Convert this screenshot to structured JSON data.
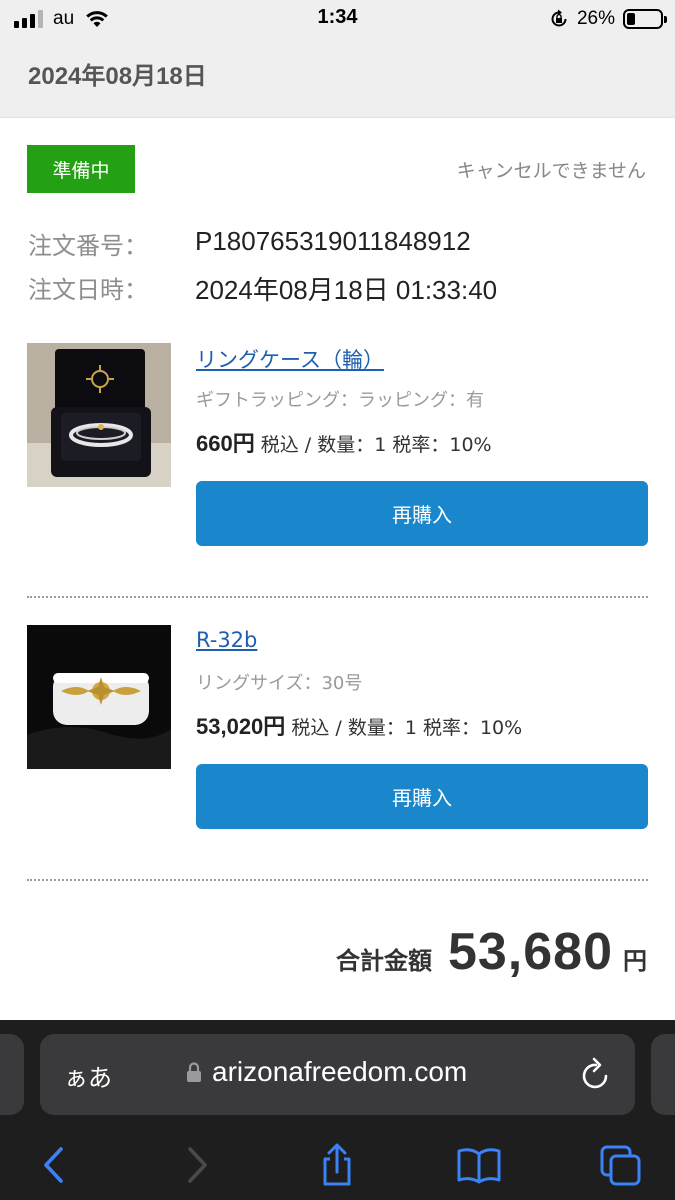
{
  "status_bar": {
    "carrier": "au",
    "time": "1:34",
    "battery_percent": "26%",
    "battery_level": 0.26
  },
  "header": {
    "date": "2024年08月18日"
  },
  "order": {
    "status": "準備中",
    "cancel_note": "キャンセルできません",
    "order_number_label": "注文番号：",
    "order_number": "P180765319011848912",
    "order_datetime_label": "注文日時：",
    "order_datetime": "2024年08月18日 01:33:40"
  },
  "products": [
    {
      "name": "リングケース（輪）",
      "option": "ギフトラッピング：ラッピング：有",
      "price": "660円",
      "price_suffix": "税込 / 数量：1 税率：10%",
      "rebuy_label": "再購入"
    },
    {
      "name": "R-32b",
      "option": "リングサイズ：30号",
      "price": "53,020円",
      "price_suffix": "税込 / 数量：1 税率：10%",
      "rebuy_label": "再購入"
    }
  ],
  "total": {
    "label": "合計金額",
    "amount": "53,680",
    "unit": "円"
  },
  "browser": {
    "aa_label": "ぁあ",
    "url": "arizonafreedom.com"
  },
  "colors": {
    "status_green": "#24a014",
    "button_blue": "#1a87cd",
    "link_blue": "#1f5fb0",
    "safari_blue": "#3b82f6"
  }
}
